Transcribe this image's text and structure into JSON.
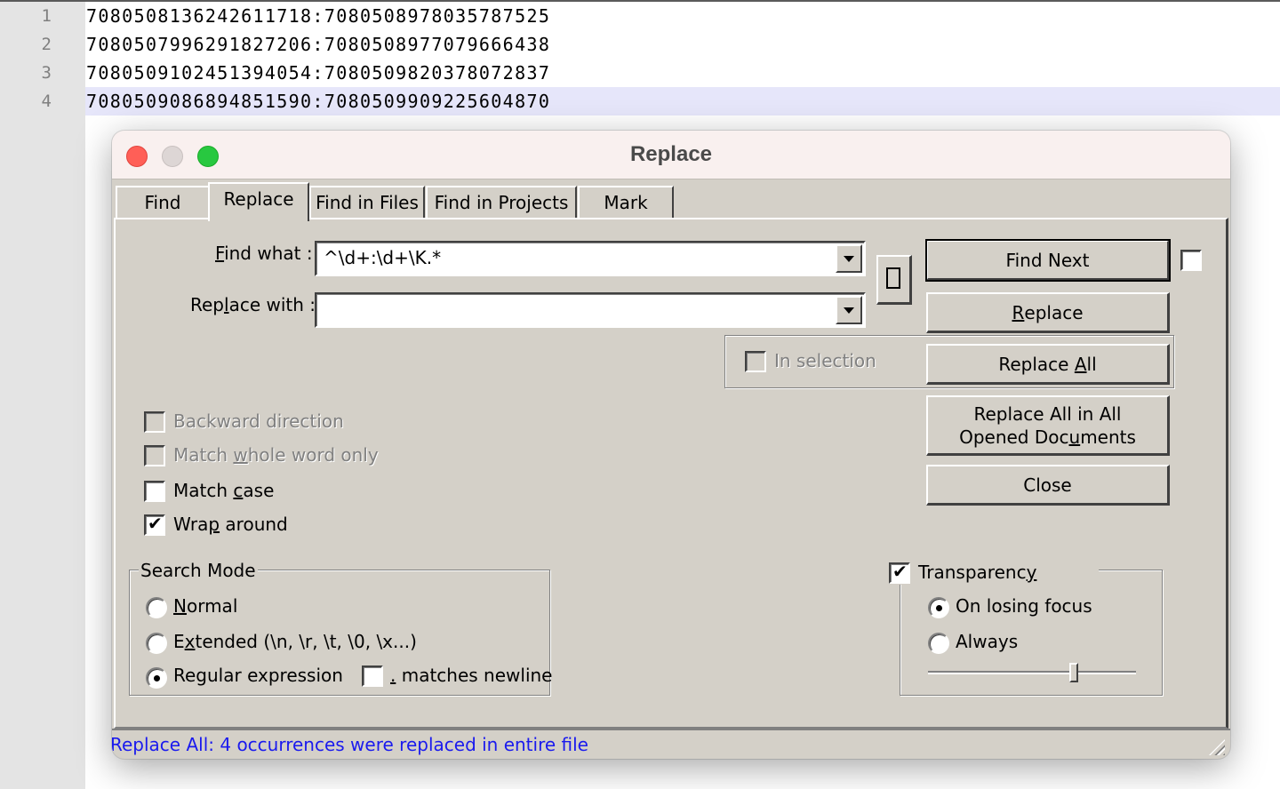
{
  "editor": {
    "lines": [
      {
        "number": "1",
        "text": "7080508136242611718:7080508978035787525"
      },
      {
        "number": "2",
        "text": "7080507996291827206:7080508977079666438"
      },
      {
        "number": "3",
        "text": "7080509102451394054:7080509820378072837"
      },
      {
        "number": "4",
        "text": "7080509086894851590:7080509909225604870"
      }
    ],
    "current_line": 4
  },
  "dialog": {
    "title": "Replace",
    "tabs": [
      {
        "label": "Find",
        "active": false
      },
      {
        "label": "Replace",
        "active": true
      },
      {
        "label": "Find in Files",
        "active": false
      },
      {
        "label": "Find in Projects",
        "active": false
      },
      {
        "label": "Mark",
        "active": false
      }
    ],
    "find_what": {
      "label_pre": "",
      "label_key": "F",
      "label_post": "ind what :",
      "value": "^\\d+:\\d+\\K.*"
    },
    "replace_with": {
      "label_pre": "Rep",
      "label_key": "l",
      "label_post": "ace with :",
      "value": ""
    },
    "swap_button_icon": "swap-rect-icon",
    "buttons": {
      "find_next": "Find Next",
      "replace": {
        "pre": "",
        "key": "R",
        "post": "eplace"
      },
      "replace_all": {
        "pre": "Replace ",
        "key": "A",
        "post": "ll"
      },
      "replace_all_docs_line1": "Replace All in All",
      "replace_all_docs_line2": {
        "pre": "Opened Doc",
        "key": "u",
        "post": "ments"
      },
      "close": "Close"
    },
    "in_selection": {
      "label": "In selection",
      "checked": false,
      "enabled": false
    },
    "options": {
      "backward_direction": {
        "label": "Backward direction",
        "checked": false,
        "enabled": false
      },
      "match_whole_word": {
        "pre": "Match ",
        "key": "w",
        "post": "hole word only",
        "checked": false,
        "enabled": false
      },
      "match_case": {
        "pre": "Match ",
        "key": "c",
        "post": "ase",
        "checked": false,
        "enabled": true
      },
      "wrap_around": {
        "pre": "Wra",
        "key": "p",
        "post": " around",
        "checked": true,
        "enabled": true
      }
    },
    "search_mode": {
      "legend": "Search Mode",
      "normal": {
        "pre": "",
        "key": "N",
        "post": "ormal",
        "selected": false
      },
      "extended": {
        "pre": "E",
        "key": "x",
        "post": "tended (\\n, \\r, \\t, \\0, \\x...)",
        "selected": false
      },
      "regex": {
        "label": "Regular expression",
        "selected": true
      },
      "dot_newline": {
        "key": ".",
        "post": " matches newline",
        "checked": false
      }
    },
    "transparency": {
      "label_pre": "Transparenc",
      "label_key": "y",
      "checked": true,
      "on_losing_focus": {
        "label": "On losing focus",
        "selected": true
      },
      "always": {
        "label": "Always",
        "selected": false
      },
      "slider_value_percent": 71
    },
    "top_right_checkbox_checked": false,
    "status": "Replace All: 4 occurrences were replaced in entire file"
  }
}
